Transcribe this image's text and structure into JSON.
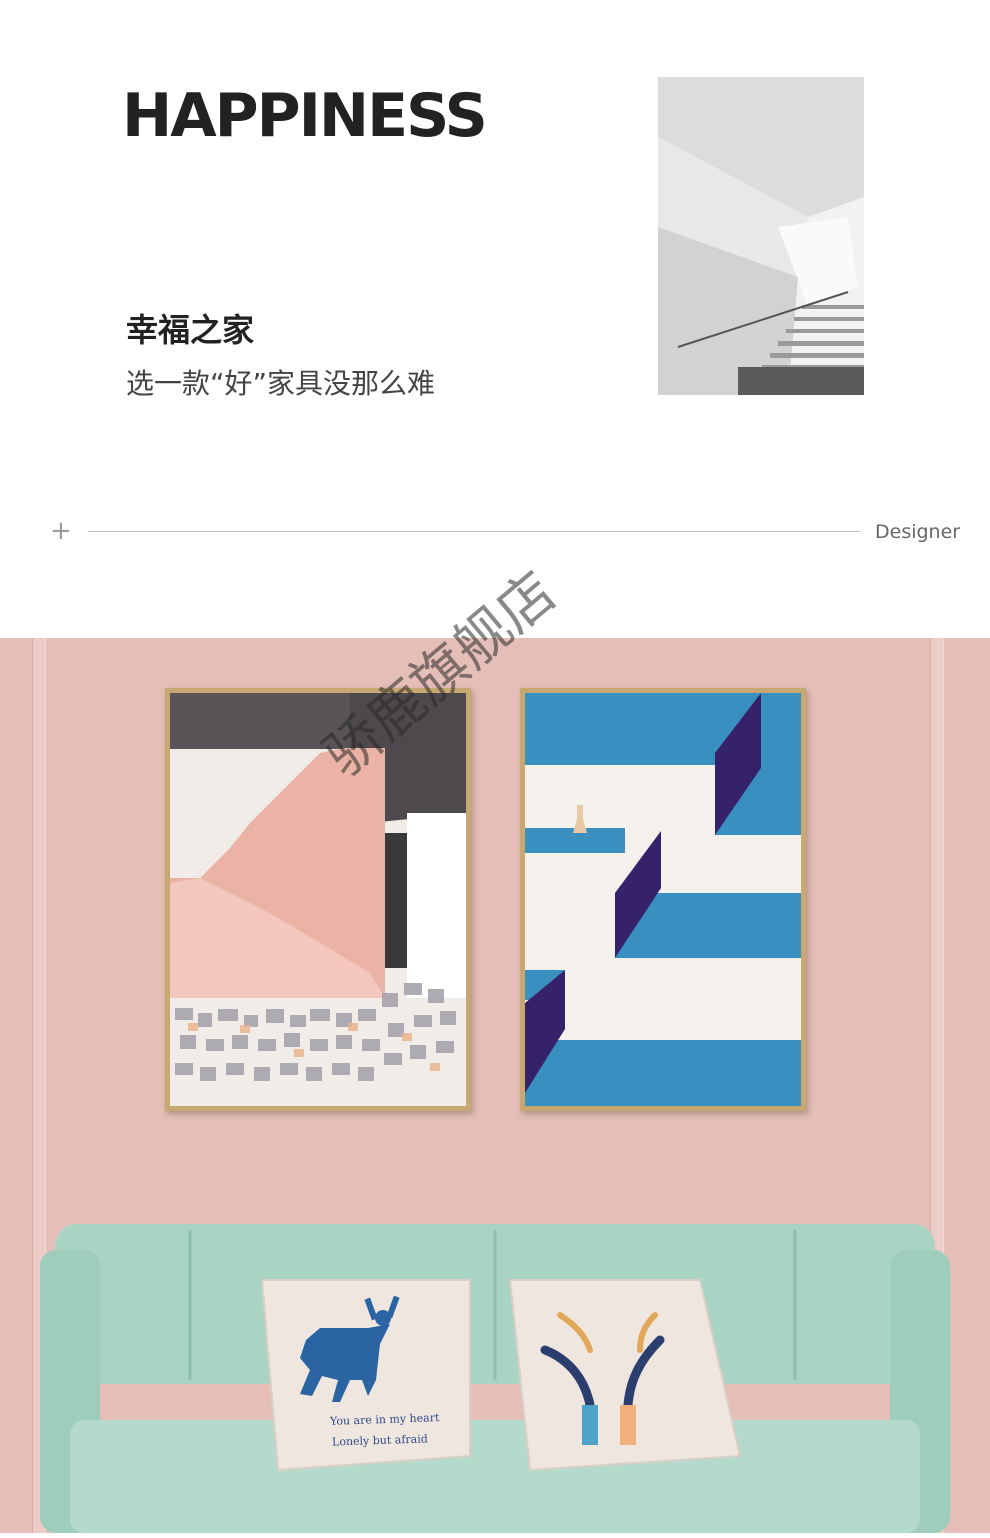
{
  "header": {
    "title": "HAPPINESS",
    "subtitle": "幸福之家",
    "tagline": "选一款“好”家具没那么难"
  },
  "divider": {
    "plus": "+",
    "label": "Designer"
  },
  "scene": {
    "watermark": "骄鹿旗舰店",
    "pillow_line_1": "You are in my heart",
    "pillow_line_2": "Lonely but afraid"
  },
  "colors": {
    "wall": "#e5bfb7",
    "frame_gold": "#c7a871",
    "sofa_mint": "#a9d4c4",
    "art_blue": "#3a8fc1",
    "art_purple": "#35226b",
    "art_pink": "#eab3a6"
  }
}
